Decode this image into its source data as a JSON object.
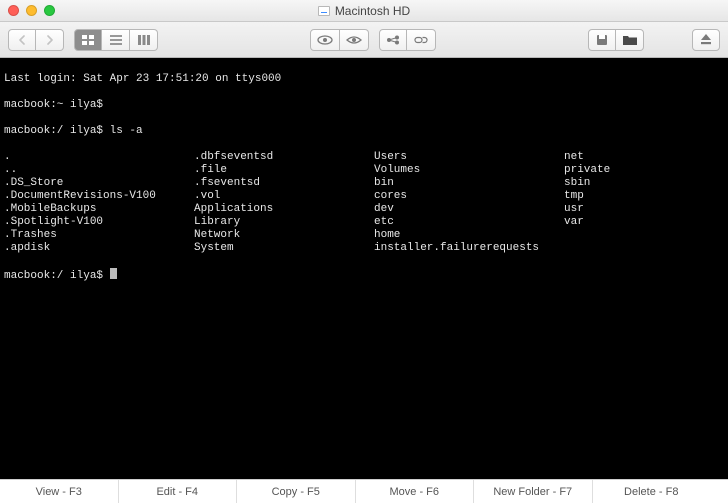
{
  "window": {
    "title": "Macintosh HD"
  },
  "terminal": {
    "last_login": "Last login: Sat Apr 23 17:51:20 on ttys000",
    "prompt1": "macbook:~ ilya$",
    "prompt2_pre": "macbook:/ ilya$ ",
    "prompt2_cmd": "ls -a",
    "prompt3": "macbook:/ ilya$ ",
    "listing": {
      "col1": [
        ".",
        "..",
        ".DS_Store",
        ".DocumentRevisions-V100",
        ".MobileBackups",
        ".Spotlight-V100",
        ".Trashes",
        ".apdisk"
      ],
      "col2": [
        ".dbfseventsd",
        ".file",
        ".fseventsd",
        ".vol",
        "Applications",
        "Library",
        "Network",
        "System"
      ],
      "col3": [
        "Users",
        "Volumes",
        "bin",
        "cores",
        "dev",
        "etc",
        "home",
        "installer.failurerequests"
      ],
      "col4": [
        "net",
        "private",
        "sbin",
        "tmp",
        "usr",
        "var",
        "",
        ""
      ]
    }
  },
  "bottombar": {
    "items": [
      "View - F3",
      "Edit - F4",
      "Copy - F5",
      "Move - F6",
      "New Folder - F7",
      "Delete - F8"
    ]
  },
  "icons": {
    "back": "back-chevron",
    "fwd": "forward-chevron",
    "view_icon": "icon-view",
    "view_list": "list-view",
    "view_col": "column-view",
    "eye": "quicklook",
    "eye2": "eye-icon",
    "link": "link-icon",
    "disk": "disk-icon",
    "folder": "folder-icon",
    "eject": "eject-icon"
  }
}
